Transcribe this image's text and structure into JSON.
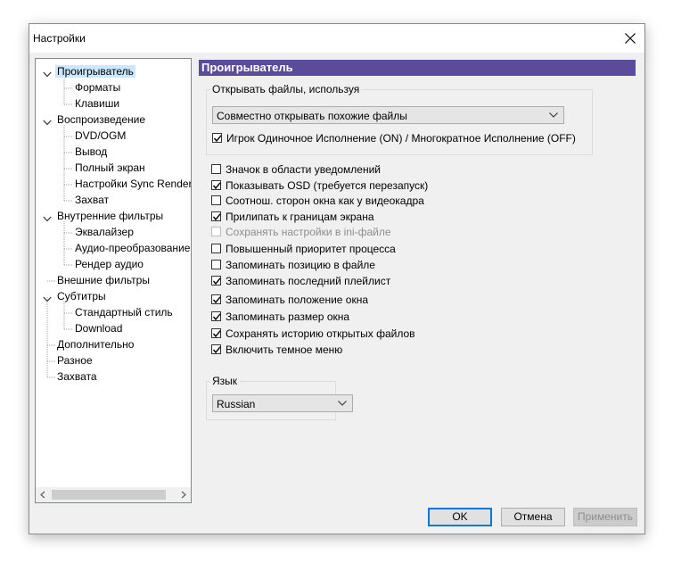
{
  "window": {
    "title": "Настройки"
  },
  "tree": {
    "items": [
      {
        "label": "Проигрыватель",
        "level": 0,
        "expandable": true,
        "selected": true
      },
      {
        "label": "Форматы",
        "level": 1
      },
      {
        "label": "Клавиши",
        "level": 1
      },
      {
        "label": "Воспроизведение",
        "level": 0,
        "expandable": true
      },
      {
        "label": "DVD/OGM",
        "level": 1
      },
      {
        "label": "Вывод",
        "level": 1
      },
      {
        "label": "Полный экран",
        "level": 1
      },
      {
        "label": "Настройки Sync Render",
        "level": 1
      },
      {
        "label": "Захват",
        "level": 1
      },
      {
        "label": "Внутренние фильтры",
        "level": 0,
        "expandable": true
      },
      {
        "label": "Эквалайзер",
        "level": 1
      },
      {
        "label": "Аудио-преобразование",
        "level": 1
      },
      {
        "label": "Рендер аудио",
        "level": 1
      },
      {
        "label": "Внешние фильтры",
        "level": 0
      },
      {
        "label": "Субтитры",
        "level": 0,
        "expandable": true
      },
      {
        "label": "Стандартный стиль",
        "level": 1
      },
      {
        "label": "Download",
        "level": 1
      },
      {
        "label": "Дополнительно",
        "level": 0
      },
      {
        "label": "Разное",
        "level": 0
      },
      {
        "label": "Захвата",
        "level": 0
      }
    ]
  },
  "page": {
    "header": "Проигрыватель",
    "open_group": {
      "label": "Открывать файлы, используя",
      "combo_value": "Совместно открывать похожие файлы",
      "checkbox": {
        "label": "Игрок Одиночное Исполнение (ON) / Многократное Исполнение (OFF)",
        "checked": true
      }
    },
    "checkboxes": [
      {
        "label": "Значок в области уведомлений",
        "checked": false
      },
      {
        "label": "Показывать OSD (требуется перезапуск)",
        "checked": true
      },
      {
        "label": "Соотнош. сторон окна как у видеокадра",
        "checked": false
      },
      {
        "label": "Прилипать к границам экрана",
        "checked": true
      },
      {
        "label": "Сохранять настройки в ini-файле",
        "checked": false,
        "disabled": true
      },
      {
        "label": "Повышенный приоритет процесса",
        "checked": false
      },
      {
        "label": "Запоминать позицию в файле",
        "checked": false
      },
      {
        "label": "Запоминать последний плейлист",
        "checked": true
      },
      {
        "label": "Запоминать положение окна",
        "checked": true
      },
      {
        "label": "Запоминать размер окна",
        "checked": true
      },
      {
        "label": "Сохранять историю открытых файлов",
        "checked": true
      },
      {
        "label": "Включить темное меню",
        "checked": true
      }
    ],
    "language_group": {
      "label": "Язык",
      "combo_value": "Russian"
    }
  },
  "buttons": {
    "ok": "OK",
    "cancel": "Отмена",
    "apply": "Применить"
  }
}
